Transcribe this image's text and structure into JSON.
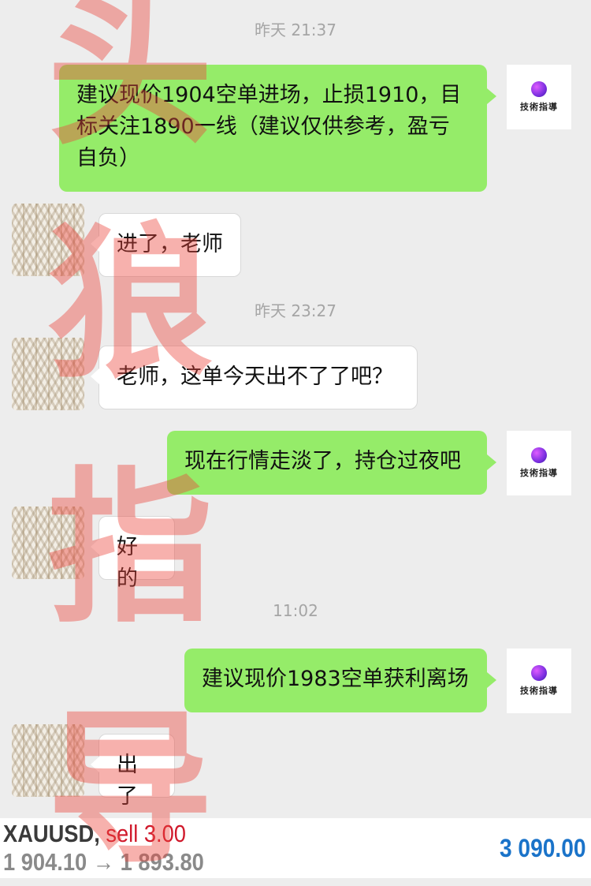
{
  "watermark": {
    "chars": [
      "头",
      "狼",
      "指",
      "导"
    ]
  },
  "chat": {
    "timestamps": [
      "昨天 21:37",
      "昨天 23:27",
      "11:02"
    ],
    "avatar_self_text": "技術指導",
    "messages": [
      {
        "side": "out",
        "text": "建议现价1904空单进场，止损1910，目标关注1890一线（建议仅供参考，盈亏自负）"
      },
      {
        "side": "in",
        "text": "进了，老师"
      },
      {
        "side": "in",
        "text": "老师，这单今天出不了了吧？"
      },
      {
        "side": "out",
        "text": "现在行情走淡了，持仓过夜吧"
      },
      {
        "side": "in",
        "text": "好的"
      },
      {
        "side": "out",
        "text": "建议现价1983空单获利离场"
      },
      {
        "side": "in",
        "text": "出了"
      }
    ]
  },
  "ticker": {
    "symbol": "XAUUSD,",
    "order": "sell 3.00",
    "prices": "1 904.10 → 1 893.80",
    "profit": "3 090.00"
  },
  "colors": {
    "outgoing_bubble": "#95ec69",
    "sell": "#d0192b",
    "profit": "#1a73c9"
  }
}
